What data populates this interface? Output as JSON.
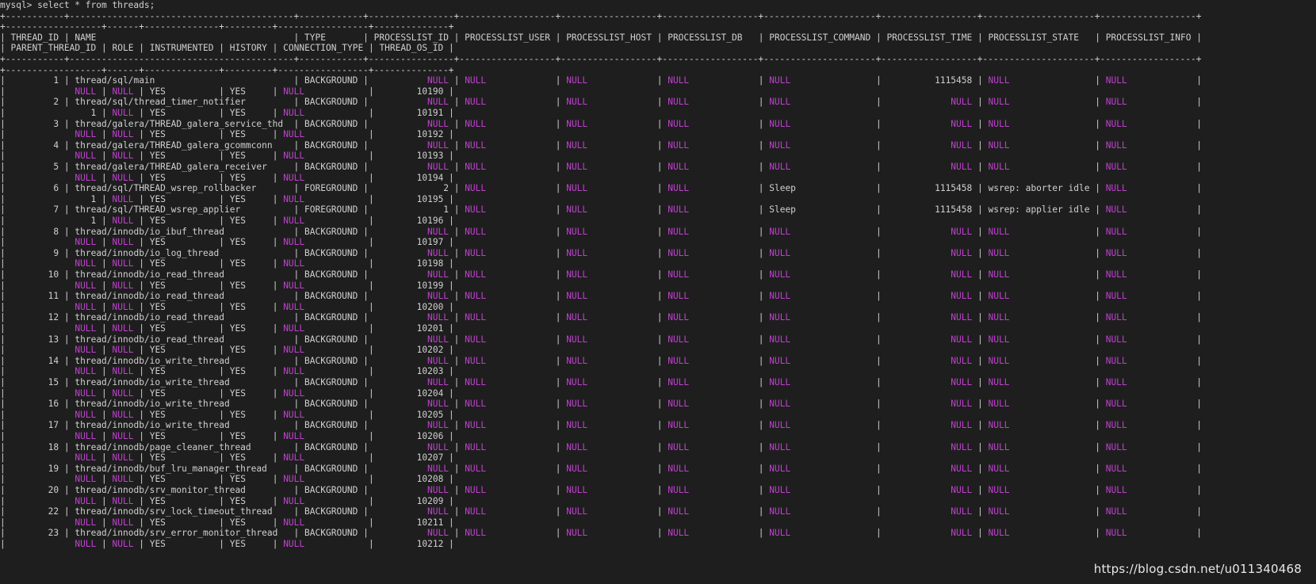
{
  "prompt": "mysql> select * from threads;",
  "header1": [
    "THREAD_ID",
    "NAME",
    "TYPE",
    "PROCESSLIST_ID",
    "PROCESSLIST_USER",
    "PROCESSLIST_HOST",
    "PROCESSLIST_DB",
    "PROCESSLIST_COMMAND",
    "PROCESSLIST_TIME",
    "PROCESSLIST_STATE",
    "PROCESSLIST_INFO"
  ],
  "header2": [
    "PARENT_THREAD_ID",
    "ROLE",
    "INSTRUMENTED",
    "HISTORY",
    "CONNECTION_TYPE",
    "THREAD_OS_ID"
  ],
  "rows": [
    {
      "id": "1",
      "name": "thread/sql/main",
      "type": "BACKGROUND",
      "pid": "NULL",
      "user": "NULL",
      "host": "NULL",
      "db": "NULL",
      "cmd": "NULL",
      "time": "1115458",
      "state": "NULL",
      "info": "NULL",
      "parent": "NULL",
      "role": "NULL",
      "instr": "YES",
      "hist": "YES",
      "conn": "NULL",
      "os": "10190"
    },
    {
      "id": "2",
      "name": "thread/sql/thread_timer_notifier",
      "type": "BACKGROUND",
      "pid": "NULL",
      "user": "NULL",
      "host": "NULL",
      "db": "NULL",
      "cmd": "NULL",
      "time": "NULL",
      "state": "NULL",
      "info": "NULL",
      "parent": "1",
      "role": "NULL",
      "instr": "YES",
      "hist": "YES",
      "conn": "NULL",
      "os": "10191"
    },
    {
      "id": "3",
      "name": "thread/galera/THREAD_galera_service_thd",
      "type": "BACKGROUND",
      "pid": "NULL",
      "user": "NULL",
      "host": "NULL",
      "db": "NULL",
      "cmd": "NULL",
      "time": "NULL",
      "state": "NULL",
      "info": "NULL",
      "parent": "NULL",
      "role": "NULL",
      "instr": "YES",
      "hist": "YES",
      "conn": "NULL",
      "os": "10192"
    },
    {
      "id": "4",
      "name": "thread/galera/THREAD_galera_gcommconn",
      "type": "BACKGROUND",
      "pid": "NULL",
      "user": "NULL",
      "host": "NULL",
      "db": "NULL",
      "cmd": "NULL",
      "time": "NULL",
      "state": "NULL",
      "info": "NULL",
      "parent": "NULL",
      "role": "NULL",
      "instr": "YES",
      "hist": "YES",
      "conn": "NULL",
      "os": "10193"
    },
    {
      "id": "5",
      "name": "thread/galera/THREAD_galera_receiver",
      "type": "BACKGROUND",
      "pid": "NULL",
      "user": "NULL",
      "host": "NULL",
      "db": "NULL",
      "cmd": "NULL",
      "time": "NULL",
      "state": "NULL",
      "info": "NULL",
      "parent": "NULL",
      "role": "NULL",
      "instr": "YES",
      "hist": "YES",
      "conn": "NULL",
      "os": "10194"
    },
    {
      "id": "6",
      "name": "thread/sql/THREAD_wsrep_rollbacker",
      "type": "FOREGROUND",
      "pid": "2",
      "user": "NULL",
      "host": "NULL",
      "db": "NULL",
      "cmd": "Sleep",
      "time": "1115458",
      "state": "wsrep: aborter idle",
      "info": "NULL",
      "parent": "1",
      "role": "NULL",
      "instr": "YES",
      "hist": "YES",
      "conn": "NULL",
      "os": "10195"
    },
    {
      "id": "7",
      "name": "thread/sql/THREAD_wsrep_applier",
      "type": "FOREGROUND",
      "pid": "1",
      "user": "NULL",
      "host": "NULL",
      "db": "NULL",
      "cmd": "Sleep",
      "time": "1115458",
      "state": "wsrep: applier idle",
      "info": "NULL",
      "parent": "1",
      "role": "NULL",
      "instr": "YES",
      "hist": "YES",
      "conn": "NULL",
      "os": "10196"
    },
    {
      "id": "8",
      "name": "thread/innodb/io_ibuf_thread",
      "type": "BACKGROUND",
      "pid": "NULL",
      "user": "NULL",
      "host": "NULL",
      "db": "NULL",
      "cmd": "NULL",
      "time": "NULL",
      "state": "NULL",
      "info": "NULL",
      "parent": "NULL",
      "role": "NULL",
      "instr": "YES",
      "hist": "YES",
      "conn": "NULL",
      "os": "10197"
    },
    {
      "id": "9",
      "name": "thread/innodb/io_log_thread",
      "type": "BACKGROUND",
      "pid": "NULL",
      "user": "NULL",
      "host": "NULL",
      "db": "NULL",
      "cmd": "NULL",
      "time": "NULL",
      "state": "NULL",
      "info": "NULL",
      "parent": "NULL",
      "role": "NULL",
      "instr": "YES",
      "hist": "YES",
      "conn": "NULL",
      "os": "10198"
    },
    {
      "id": "10",
      "name": "thread/innodb/io_read_thread",
      "type": "BACKGROUND",
      "pid": "NULL",
      "user": "NULL",
      "host": "NULL",
      "db": "NULL",
      "cmd": "NULL",
      "time": "NULL",
      "state": "NULL",
      "info": "NULL",
      "parent": "NULL",
      "role": "NULL",
      "instr": "YES",
      "hist": "YES",
      "conn": "NULL",
      "os": "10199"
    },
    {
      "id": "11",
      "name": "thread/innodb/io_read_thread",
      "type": "BACKGROUND",
      "pid": "NULL",
      "user": "NULL",
      "host": "NULL",
      "db": "NULL",
      "cmd": "NULL",
      "time": "NULL",
      "state": "NULL",
      "info": "NULL",
      "parent": "NULL",
      "role": "NULL",
      "instr": "YES",
      "hist": "YES",
      "conn": "NULL",
      "os": "10200"
    },
    {
      "id": "12",
      "name": "thread/innodb/io_read_thread",
      "type": "BACKGROUND",
      "pid": "NULL",
      "user": "NULL",
      "host": "NULL",
      "db": "NULL",
      "cmd": "NULL",
      "time": "NULL",
      "state": "NULL",
      "info": "NULL",
      "parent": "NULL",
      "role": "NULL",
      "instr": "YES",
      "hist": "YES",
      "conn": "NULL",
      "os": "10201"
    },
    {
      "id": "13",
      "name": "thread/innodb/io_read_thread",
      "type": "BACKGROUND",
      "pid": "NULL",
      "user": "NULL",
      "host": "NULL",
      "db": "NULL",
      "cmd": "NULL",
      "time": "NULL",
      "state": "NULL",
      "info": "NULL",
      "parent": "NULL",
      "role": "NULL",
      "instr": "YES",
      "hist": "YES",
      "conn": "NULL",
      "os": "10202"
    },
    {
      "id": "14",
      "name": "thread/innodb/io_write_thread",
      "type": "BACKGROUND",
      "pid": "NULL",
      "user": "NULL",
      "host": "NULL",
      "db": "NULL",
      "cmd": "NULL",
      "time": "NULL",
      "state": "NULL",
      "info": "NULL",
      "parent": "NULL",
      "role": "NULL",
      "instr": "YES",
      "hist": "YES",
      "conn": "NULL",
      "os": "10203"
    },
    {
      "id": "15",
      "name": "thread/innodb/io_write_thread",
      "type": "BACKGROUND",
      "pid": "NULL",
      "user": "NULL",
      "host": "NULL",
      "db": "NULL",
      "cmd": "NULL",
      "time": "NULL",
      "state": "NULL",
      "info": "NULL",
      "parent": "NULL",
      "role": "NULL",
      "instr": "YES",
      "hist": "YES",
      "conn": "NULL",
      "os": "10204"
    },
    {
      "id": "16",
      "name": "thread/innodb/io_write_thread",
      "type": "BACKGROUND",
      "pid": "NULL",
      "user": "NULL",
      "host": "NULL",
      "db": "NULL",
      "cmd": "NULL",
      "time": "NULL",
      "state": "NULL",
      "info": "NULL",
      "parent": "NULL",
      "role": "NULL",
      "instr": "YES",
      "hist": "YES",
      "conn": "NULL",
      "os": "10205"
    },
    {
      "id": "17",
      "name": "thread/innodb/io_write_thread",
      "type": "BACKGROUND",
      "pid": "NULL",
      "user": "NULL",
      "host": "NULL",
      "db": "NULL",
      "cmd": "NULL",
      "time": "NULL",
      "state": "NULL",
      "info": "NULL",
      "parent": "NULL",
      "role": "NULL",
      "instr": "YES",
      "hist": "YES",
      "conn": "NULL",
      "os": "10206"
    },
    {
      "id": "18",
      "name": "thread/innodb/page_cleaner_thread",
      "type": "BACKGROUND",
      "pid": "NULL",
      "user": "NULL",
      "host": "NULL",
      "db": "NULL",
      "cmd": "NULL",
      "time": "NULL",
      "state": "NULL",
      "info": "NULL",
      "parent": "NULL",
      "role": "NULL",
      "instr": "YES",
      "hist": "YES",
      "conn": "NULL",
      "os": "10207"
    },
    {
      "id": "19",
      "name": "thread/innodb/buf_lru_manager_thread",
      "type": "BACKGROUND",
      "pid": "NULL",
      "user": "NULL",
      "host": "NULL",
      "db": "NULL",
      "cmd": "NULL",
      "time": "NULL",
      "state": "NULL",
      "info": "NULL",
      "parent": "NULL",
      "role": "NULL",
      "instr": "YES",
      "hist": "YES",
      "conn": "NULL",
      "os": "10208"
    },
    {
      "id": "20",
      "name": "thread/innodb/srv_monitor_thread",
      "type": "BACKGROUND",
      "pid": "NULL",
      "user": "NULL",
      "host": "NULL",
      "db": "NULL",
      "cmd": "NULL",
      "time": "NULL",
      "state": "NULL",
      "info": "NULL",
      "parent": "NULL",
      "role": "NULL",
      "instr": "YES",
      "hist": "YES",
      "conn": "NULL",
      "os": "10209"
    },
    {
      "id": "22",
      "name": "thread/innodb/srv_lock_timeout_thread",
      "type": "BACKGROUND",
      "pid": "NULL",
      "user": "NULL",
      "host": "NULL",
      "db": "NULL",
      "cmd": "NULL",
      "time": "NULL",
      "state": "NULL",
      "info": "NULL",
      "parent": "NULL",
      "role": "NULL",
      "instr": "YES",
      "hist": "YES",
      "conn": "NULL",
      "os": "10211"
    },
    {
      "id": "23",
      "name": "thread/innodb/srv_error_monitor_thread",
      "type": "BACKGROUND",
      "pid": "NULL",
      "user": "NULL",
      "host": "NULL",
      "db": "NULL",
      "cmd": "NULL",
      "time": "NULL",
      "state": "NULL",
      "info": "NULL",
      "parent": "NULL",
      "role": "NULL",
      "instr": "YES",
      "hist": "YES",
      "conn": "NULL",
      "os": "10212"
    }
  ],
  "watermark": "https://blog.csdn.net/u011340468",
  "colors": {
    "background": "#1e1e1e",
    "text": "#d0d0d0",
    "null": "#c040d0"
  }
}
